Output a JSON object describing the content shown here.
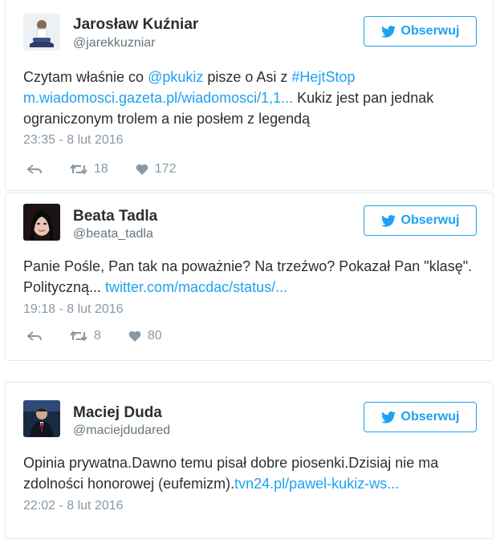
{
  "tweets": [
    {
      "name": "Jarosław Kuźniar",
      "handle": "@jarekkuzniar",
      "follow_label": "Obserwuj",
      "text": [
        {
          "t": "Czytam właśnie co ",
          "link": false
        },
        {
          "t": "@pkukiz",
          "link": true
        },
        {
          "t": " pisze o Asi z ",
          "link": false
        },
        {
          "t": "#HejtStop",
          "link": true
        },
        {
          "t": " ",
          "link": false
        },
        {
          "t": "m.wiadomosci.gazeta.pl/wiadomosci/1,1...",
          "link": true
        },
        {
          "t": " Kukiz jest pan jednak ograniczonym trolem a nie posłem z legendą",
          "link": false
        }
      ],
      "timestamp": "23:35 - 8 lut 2016",
      "retweets": "18",
      "likes": "172"
    },
    {
      "name": "Beata Tadla",
      "handle": "@beata_tadla",
      "follow_label": "Obserwuj",
      "text": [
        {
          "t": "Panie Pośle, Pan tak na poważnie? Na trzeźwo? Pokazał Pan \"klasę\". Polityczną... ",
          "link": false
        },
        {
          "t": "twitter.com/macdac/status/...",
          "link": true
        }
      ],
      "timestamp": "19:18 - 8 lut 2016",
      "retweets": "8",
      "likes": "80"
    },
    {
      "name": "Maciej Duda",
      "handle": "@maciejdudared",
      "follow_label": "Obserwuj",
      "text": [
        {
          "t": "Opinia prywatna.Dawno temu pisał dobre piosenki.Dzisiaj nie ma zdolności honorowej (eufemizm).",
          "link": false
        },
        {
          "t": "tvn24.pl/pawel-kukiz-ws...",
          "link": true
        }
      ],
      "timestamp": "22:02 - 8 lut 2016"
    }
  ],
  "icons": {
    "follow": "twitter-bird-icon",
    "reply": "reply-icon",
    "retweet": "retweet-icon",
    "like": "heart-icon"
  },
  "colors": {
    "accent": "#1da1f2",
    "text": "#292f33",
    "muted": "#8899a6",
    "border": "#e1e8ed"
  }
}
